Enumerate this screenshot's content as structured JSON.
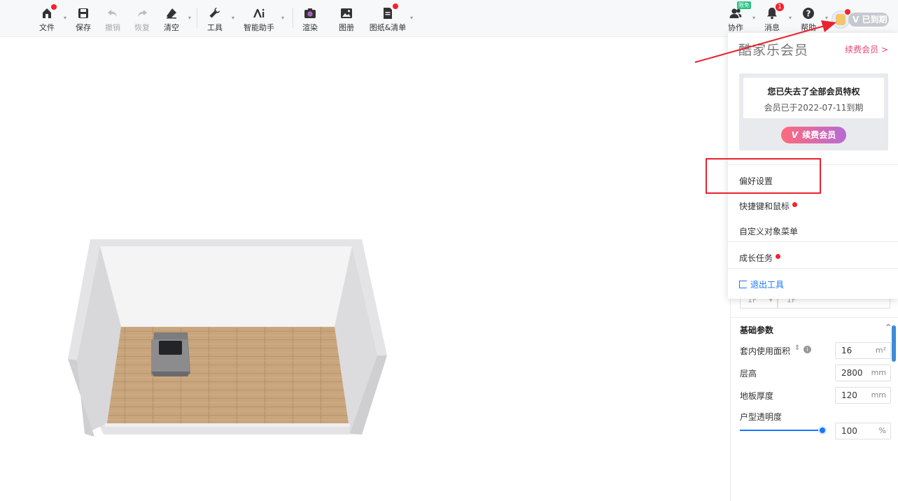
{
  "toolbar": {
    "file": "文件",
    "save": "保存",
    "undo": "撤销",
    "redo": "恢复",
    "clear": "清空",
    "tools": "工具",
    "ai_assistant": "智能助手",
    "render": "渲染",
    "gallery": "图册",
    "drawings": "图纸&清单",
    "collaborate": "协作",
    "collaborate_badge": "限免",
    "messages": "消息",
    "messages_count": "1",
    "help": "帮助",
    "vip_status": "已到期"
  },
  "menu": {
    "brand": "酷家乐会员",
    "renew_link": "续费会员 >",
    "lost_title": "您已失去了全部会员特权",
    "expired_note": "会员已于2022-07-11到期",
    "renew_button": "续费会员",
    "renew_button_icon": "V",
    "items": [
      {
        "label": "偏好设置"
      },
      {
        "label": "快捷键和鼠标"
      },
      {
        "label": "自定义对象菜单"
      },
      {
        "label": "成长任务"
      }
    ],
    "logout": "退出工具"
  },
  "panel": {
    "floor_select": "1F",
    "floor_name": "1F",
    "section_title": "基础参数",
    "fields": [
      {
        "label": "套内使用面积",
        "value": "16",
        "unit": "m²"
      },
      {
        "label": "层高",
        "value": "2800",
        "unit": "mm"
      },
      {
        "label": "地板厚度",
        "value": "120",
        "unit": "mm"
      },
      {
        "label": "户型透明度",
        "value": "100",
        "unit": "%"
      }
    ]
  },
  "colors": {
    "accent_blue": "#1677ff",
    "alert_red": "#f5222d",
    "annotation_red": "#e8232e",
    "renew_pink": "#e6457a"
  }
}
